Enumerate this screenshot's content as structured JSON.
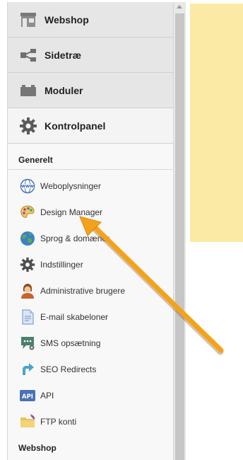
{
  "main_nav": [
    {
      "label": "Webshop",
      "icon": "shop-icon"
    },
    {
      "label": "Sidetræ",
      "icon": "sitemap-icon"
    },
    {
      "label": "Moduler",
      "icon": "modules-icon"
    },
    {
      "label": "Kontrolpanel",
      "icon": "gear-icon"
    }
  ],
  "sections": {
    "generelt": "Generelt",
    "webshop": "Webshop"
  },
  "sub_items": [
    {
      "label": "Weboplysninger",
      "icon": "www-globe-icon"
    },
    {
      "label": "Design Manager",
      "icon": "palette-icon"
    },
    {
      "label": "Sprog & domæner",
      "icon": "globe-icon"
    },
    {
      "label": "Indstillinger",
      "icon": "settings-gear-icon"
    },
    {
      "label": "Administrative brugere",
      "icon": "user-avatar-icon"
    },
    {
      "label": "E-mail skabeloner",
      "icon": "document-icon"
    },
    {
      "label": "SMS opsætning",
      "icon": "sms-chat-icon"
    },
    {
      "label": "SEO Redirects",
      "icon": "redirect-arrow-icon"
    },
    {
      "label": "API",
      "icon": "api-icon"
    },
    {
      "label": "FTP konti",
      "icon": "folder-icon"
    }
  ],
  "colors": {
    "panel_yellow": "#faeaa6",
    "annotation_arrow": "#f5a21b"
  }
}
